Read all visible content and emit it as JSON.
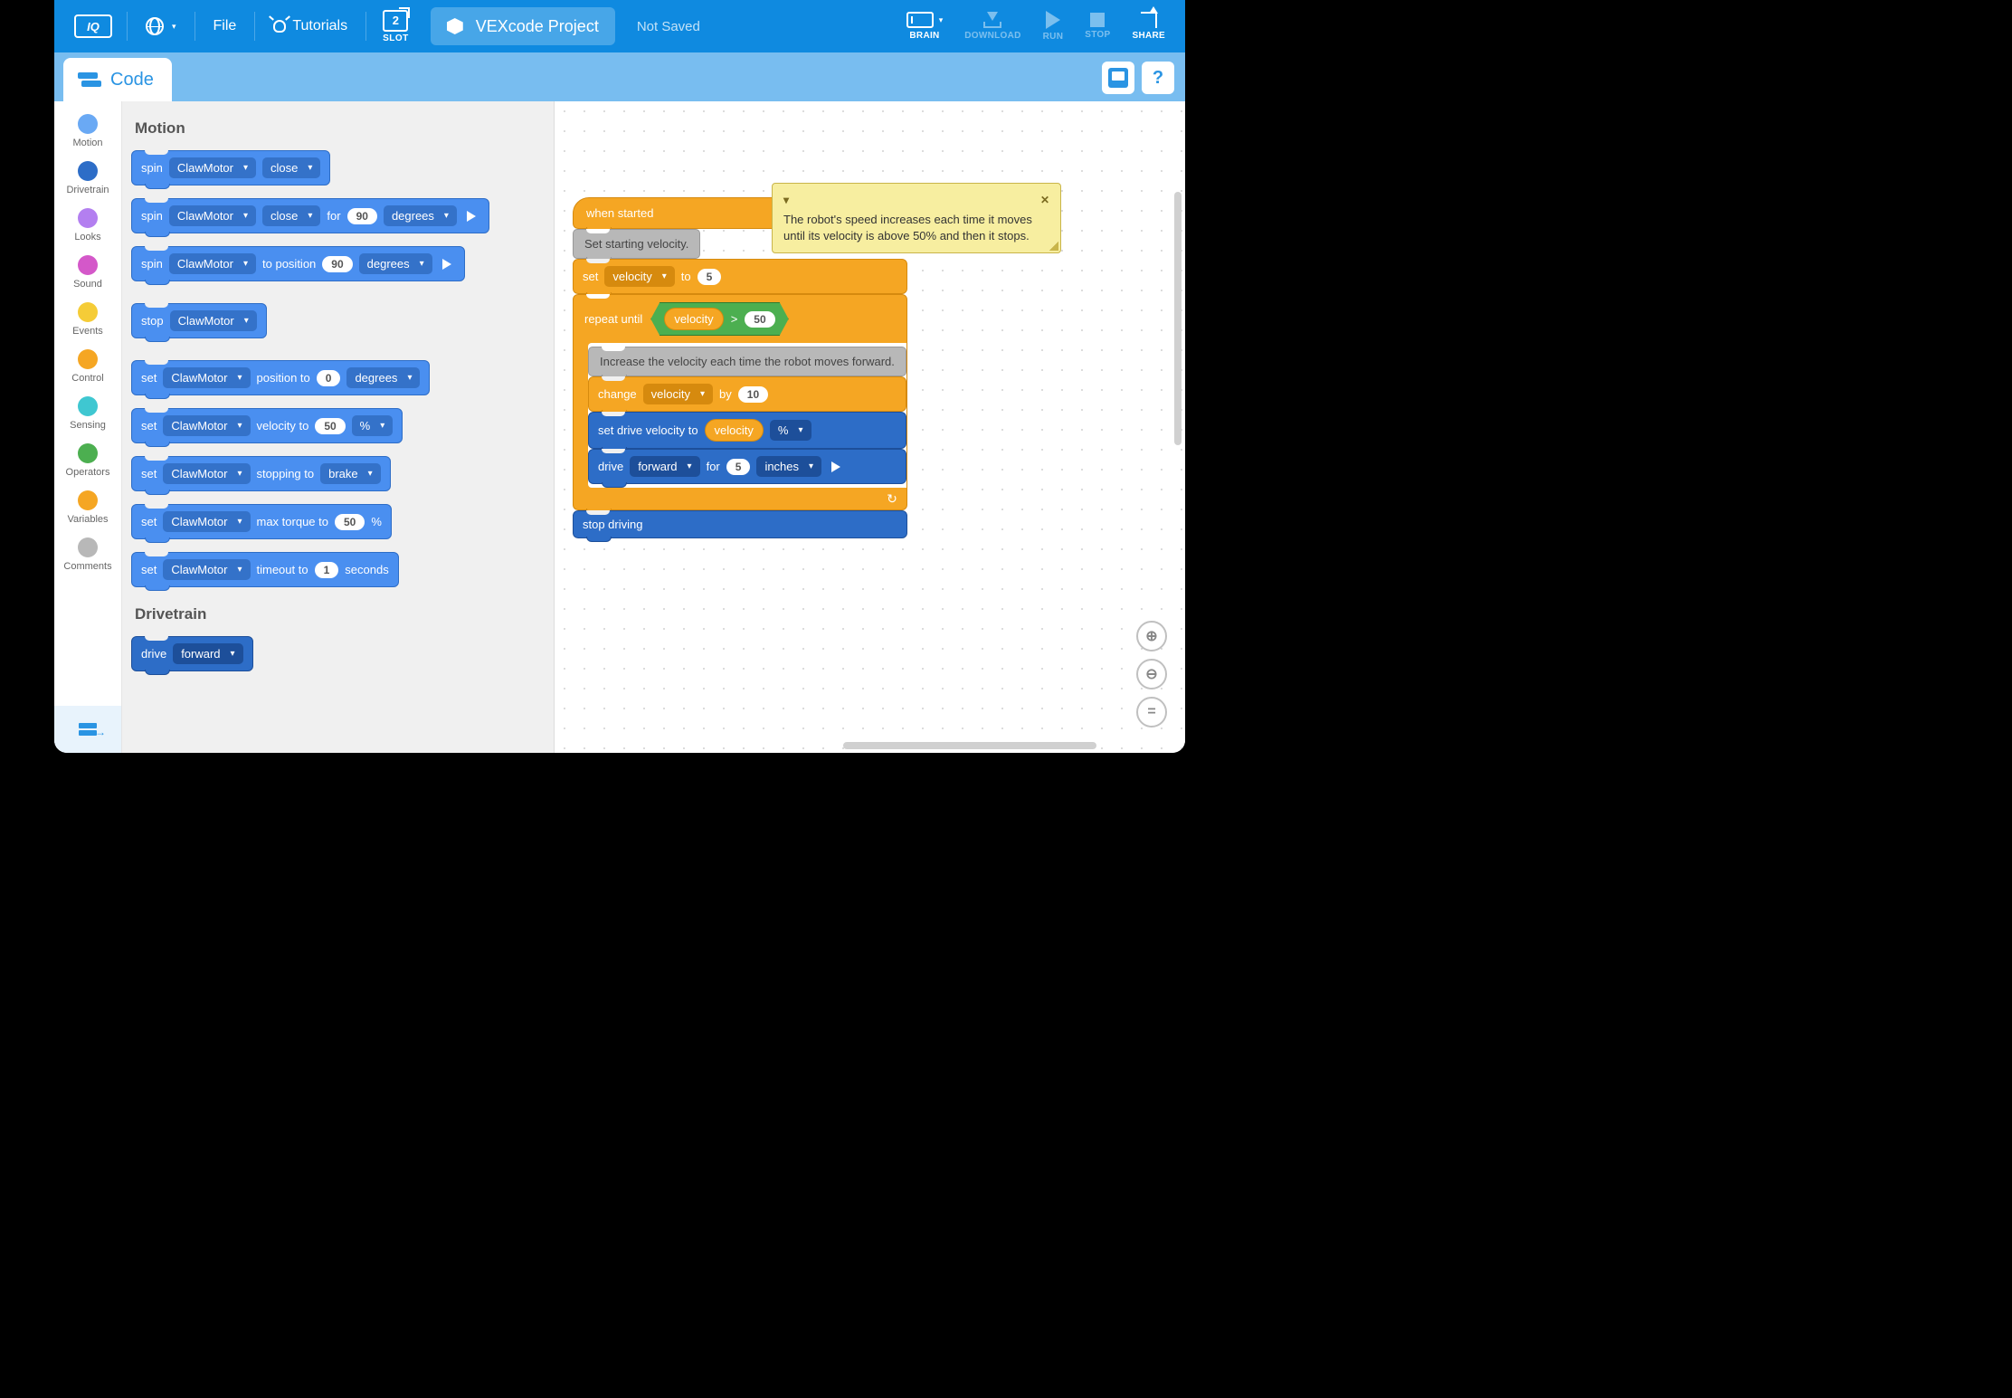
{
  "topbar": {
    "logo": "IQ",
    "file": "File",
    "tutorials": "Tutorials",
    "slot_num": "2",
    "slot_lab": "SLOT",
    "project": "VEXcode Project",
    "status": "Not Saved",
    "brain": "BRAIN",
    "download": "DOWNLOAD",
    "run": "RUN",
    "stop": "STOP",
    "share": "SHARE"
  },
  "subbar": {
    "code": "Code",
    "help": "?"
  },
  "categories": [
    {
      "name": "Motion",
      "color": "#6aa9f4"
    },
    {
      "name": "Drivetrain",
      "color": "#2d6dc7"
    },
    {
      "name": "Looks",
      "color": "#b37ff0"
    },
    {
      "name": "Sound",
      "color": "#d458c9"
    },
    {
      "name": "Events",
      "color": "#f5cc37"
    },
    {
      "name": "Control",
      "color": "#f5a623"
    },
    {
      "name": "Sensing",
      "color": "#3fc7d1"
    },
    {
      "name": "Operators",
      "color": "#4caf50"
    },
    {
      "name": "Variables",
      "color": "#f5a623"
    },
    {
      "name": "Comments",
      "color": "#b8b8b8"
    }
  ],
  "palette": {
    "motion_h": "Motion",
    "drivetrain_h": "Drivetrain",
    "b1": {
      "spin": "spin",
      "motor": "ClawMotor",
      "dir": "close"
    },
    "b2": {
      "spin": "spin",
      "motor": "ClawMotor",
      "dir": "close",
      "for": "for",
      "num": "90",
      "unit": "degrees"
    },
    "b3": {
      "spin": "spin",
      "motor": "ClawMotor",
      "to": "to position",
      "num": "90",
      "unit": "degrees"
    },
    "b4": {
      "stop": "stop",
      "motor": "ClawMotor"
    },
    "b5": {
      "set": "set",
      "motor": "ClawMotor",
      "pos": "position to",
      "num": "0",
      "unit": "degrees"
    },
    "b6": {
      "set": "set",
      "motor": "ClawMotor",
      "vel": "velocity to",
      "num": "50",
      "unit": "%"
    },
    "b7": {
      "set": "set",
      "motor": "ClawMotor",
      "stp": "stopping to",
      "mode": "brake"
    },
    "b8": {
      "set": "set",
      "motor": "ClawMotor",
      "tor": "max torque to",
      "num": "50",
      "unit": "%"
    },
    "b9": {
      "set": "set",
      "motor": "ClawMotor",
      "tim": "timeout to",
      "num": "1",
      "unit": "seconds"
    },
    "b10": {
      "drive": "drive",
      "dir": "forward"
    }
  },
  "canvas": {
    "hat": "when started",
    "c1": "Set starting velocity.",
    "set": "set",
    "velocity": "velocity",
    "to": "to",
    "five": "5",
    "repeat": "repeat until",
    "gt": ">",
    "fifty": "50",
    "c2": "Increase the velocity each time the robot moves forward.",
    "change": "change",
    "by": "by",
    "ten": "10",
    "setdrive": "set drive velocity to",
    "pct": "%",
    "drive": "drive",
    "forward": "forward",
    "for": "for",
    "d5": "5",
    "inches": "inches",
    "stopdrive": "stop driving",
    "note": "The robot's speed increases each time it moves until its velocity is above 50% and then it stops.",
    "note_collapse": "▾",
    "note_close": "✕"
  },
  "zoom": {
    "in": "⊕",
    "out": "⊖",
    "eq": "="
  }
}
